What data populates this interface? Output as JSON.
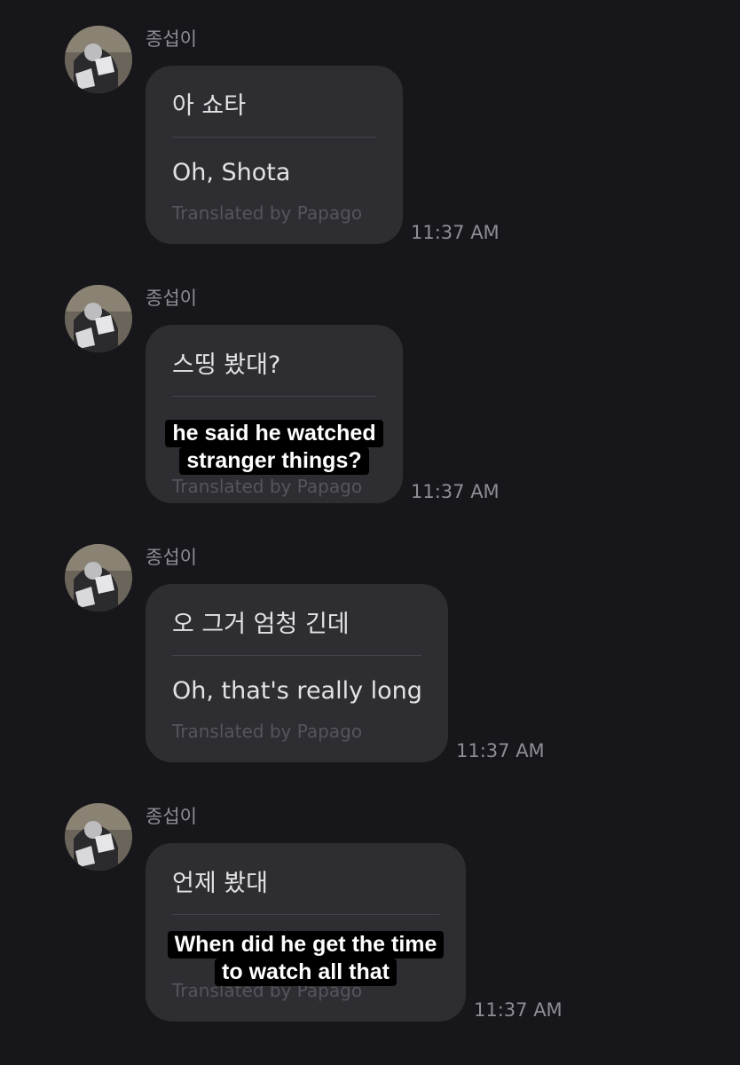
{
  "messages": [
    {
      "sender": "종섭이",
      "original": "아 쇼타",
      "translation": "Oh, Shota",
      "credit": "Translated by Papago",
      "time": "11:37 AM"
    },
    {
      "sender": "종섭이",
      "original": "스띵 봤대?",
      "credit": "Translated by Papago",
      "time": "11:37 AM",
      "caption": [
        "he said he watched",
        "stranger things?"
      ]
    },
    {
      "sender": "종섭이",
      "original": "오 그거 엄청 긴데",
      "translation": "Oh, that's really long",
      "credit": "Translated by Papago",
      "time": "11:37 AM"
    },
    {
      "sender": "종섭이",
      "original": "언제 봤대",
      "credit": "Translated by Papago",
      "time": "11:37 AM",
      "caption": [
        "When did he get the time",
        "to watch all that"
      ]
    }
  ]
}
